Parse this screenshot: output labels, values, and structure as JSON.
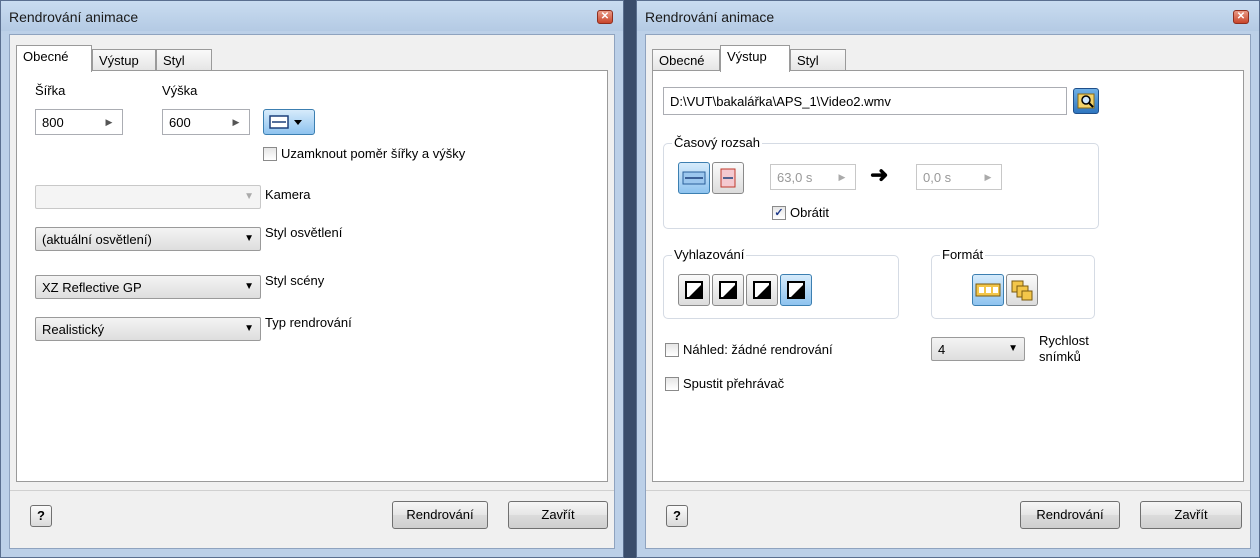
{
  "left_window": {
    "title": "Rendrování animace",
    "tabs": [
      "Obecné",
      "Výstup",
      "Styl"
    ],
    "width_label": "Šířka",
    "height_label": "Výška",
    "width_value": "800",
    "height_value": "600",
    "lock_ratio_label": "Uzamknout poměr šířky a výšky",
    "camera_label": "Kamera",
    "camera_value": "",
    "lighting_label": "Styl osvětlení",
    "lighting_value": "(aktuální osvětlení)",
    "scene_label": "Styl scény",
    "scene_value": "XZ Reflective GP",
    "render_type_label": "Typ rendrování",
    "render_type_value": "Realistický",
    "help_label": "?",
    "render_button": "Rendrování",
    "close_button": "Zavřít"
  },
  "right_window": {
    "title": "Rendrování animace",
    "tabs": [
      "Obecné",
      "Výstup",
      "Styl"
    ],
    "output_path": "D:\\VUT\\bakalářka\\APS_1\\Video2.wmv",
    "time_range_label": "Časový rozsah",
    "start_value": "63,0 s",
    "end_value": "0,0 s",
    "reverse_label": "Obrátit",
    "reverse_checked": "✓",
    "antialias_label": "Vyhlazování",
    "format_label": "Formát",
    "preview_label": "Náhled: žádné rendrování",
    "launch_player_label": "Spustit přehrávač",
    "fps_value": "4",
    "fps_label_1": "Rychlost",
    "fps_label_2": "snímků",
    "help_label": "?",
    "render_button": "Rendrování",
    "close_button": "Zavřít"
  }
}
